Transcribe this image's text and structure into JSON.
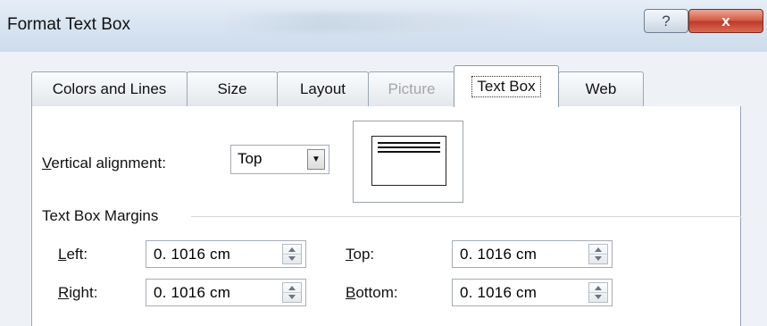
{
  "window": {
    "title": "Format Text Box",
    "help_glyph": "?",
    "close_glyph": "x"
  },
  "tabs": [
    {
      "label": "Colors and Lines",
      "state": "normal"
    },
    {
      "label": "Size",
      "state": "normal"
    },
    {
      "label": "Layout",
      "state": "normal"
    },
    {
      "label": "Picture",
      "state": "disabled"
    },
    {
      "label": "Text Box",
      "state": "active"
    },
    {
      "label": "Web",
      "state": "normal"
    }
  ],
  "vertical_alignment": {
    "label_mnemonic": "V",
    "label_rest": "ertical alignment:",
    "value": "Top",
    "dropdown_icon": "triangle-down"
  },
  "margins": {
    "group_label": "Text Box Margins",
    "left": {
      "label_mnemonic": "L",
      "label_rest": "eft:",
      "value": "0. 1016 cm"
    },
    "right": {
      "label_mnemonic": "R",
      "label_rest": "ight:",
      "value": "0. 1016 cm"
    },
    "top": {
      "label_mnemonic": "T",
      "label_rest": "op:",
      "value": "0. 1016 cm"
    },
    "bottom": {
      "label_mnemonic": "B",
      "label_rest": "ottom:",
      "value": "0. 1016 cm"
    }
  }
}
